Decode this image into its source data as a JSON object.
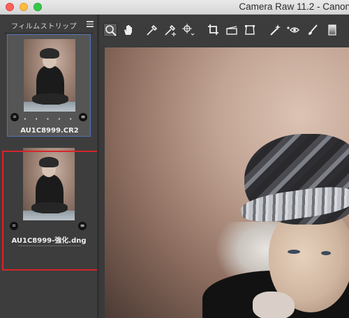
{
  "window": {
    "title": "Camera Raw 11.2  -  Canon"
  },
  "filmstrip": {
    "title": "フィルムストリップ",
    "items": [
      {
        "filename": "AU1C8999.CR2",
        "rating_dots": "• • • • •",
        "selected": true
      },
      {
        "filename": "AU1C8999-強化.dng",
        "rating_dots": "",
        "selected": false
      }
    ]
  },
  "toolbar": {
    "tools": [
      {
        "icon": "zoom-icon",
        "active": true
      },
      {
        "icon": "hand-icon",
        "active": false
      },
      {
        "icon": "white-balance-icon",
        "active": false
      },
      {
        "icon": "color-sampler-icon",
        "active": false
      },
      {
        "icon": "targeted-adjustment-icon",
        "active": false
      },
      {
        "icon": "crop-icon",
        "active": false
      },
      {
        "icon": "straighten-icon",
        "active": false
      },
      {
        "icon": "transform-icon",
        "active": false
      },
      {
        "icon": "spot-removal-icon",
        "active": false
      },
      {
        "icon": "red-eye-icon",
        "active": false
      },
      {
        "icon": "adjustment-brush-icon",
        "active": false
      },
      {
        "icon": "graduated-filter-icon",
        "active": false
      }
    ]
  },
  "colors": {
    "highlight_red": "#d6252c",
    "selection_blue": "#5573b8"
  }
}
